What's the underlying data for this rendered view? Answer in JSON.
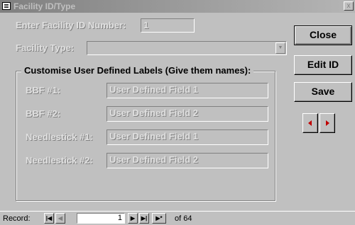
{
  "window": {
    "title": "Facility ID/Type",
    "close_glyph": "x"
  },
  "form": {
    "facility_id_label": "Enter Facility ID Number:",
    "facility_id_value": "1",
    "facility_type_label": "Facility Type:",
    "facility_type_value": "",
    "group_title": "Customise User Defined Labels (Give them names):",
    "fields": [
      {
        "label": "BBF #1:",
        "value": "User Defined Field 1"
      },
      {
        "label": "BBF #2:",
        "value": "User Defined Field 2"
      },
      {
        "label": "Needlestick #1:",
        "value": "User Defined Field 1"
      },
      {
        "label": "Needlestick #2:",
        "value": "User Defined Field 2"
      }
    ]
  },
  "buttons": {
    "close_label": "Close",
    "edit_id_label": "Edit ID",
    "save_label": "Save",
    "prev_icon": "triangle-left-icon",
    "next_icon": "triangle-right-icon"
  },
  "record_nav": {
    "label": "Record:",
    "current": "1",
    "total_text": "of  64",
    "first_glyph": "|◀",
    "prev_glyph": "◀",
    "next_glyph": "▶",
    "last_glyph": "▶|",
    "new_glyph": "▶*"
  },
  "colors": {
    "form_bg": "#c0c0c0",
    "accent_arrow": "#c00000",
    "disabled_text": "#e0e0e0"
  }
}
